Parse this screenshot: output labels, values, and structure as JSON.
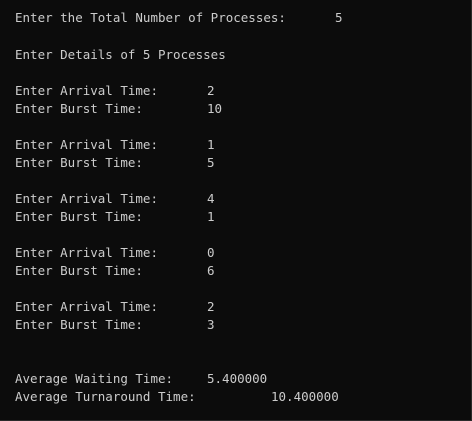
{
  "console": {
    "total_prompt": "Enter the Total Number of Processes:",
    "total_value": "5",
    "details_heading": "Enter Details of 5 Processes",
    "processes": [
      {
        "arrival_label": "Enter Arrival Time:",
        "arrival_value": "2",
        "burst_label": "Enter Burst Time:",
        "burst_value": "10"
      },
      {
        "arrival_label": "Enter Arrival Time:",
        "arrival_value": "1",
        "burst_label": "Enter Burst Time:",
        "burst_value": "5"
      },
      {
        "arrival_label": "Enter Arrival Time:",
        "arrival_value": "4",
        "burst_label": "Enter Burst Time:",
        "burst_value": "1"
      },
      {
        "arrival_label": "Enter Arrival Time:",
        "arrival_value": "0",
        "burst_label": "Enter Burst Time:",
        "burst_value": "6"
      },
      {
        "arrival_label": "Enter Arrival Time:",
        "arrival_value": "2",
        "burst_label": "Enter Burst Time:",
        "burst_value": "3"
      }
    ],
    "avg_waiting_label": "Average Waiting Time:",
    "avg_waiting_value": "5.400000",
    "avg_turnaround_label": "Average Turnaround Time:",
    "avg_turnaround_value": "10.400000"
  }
}
